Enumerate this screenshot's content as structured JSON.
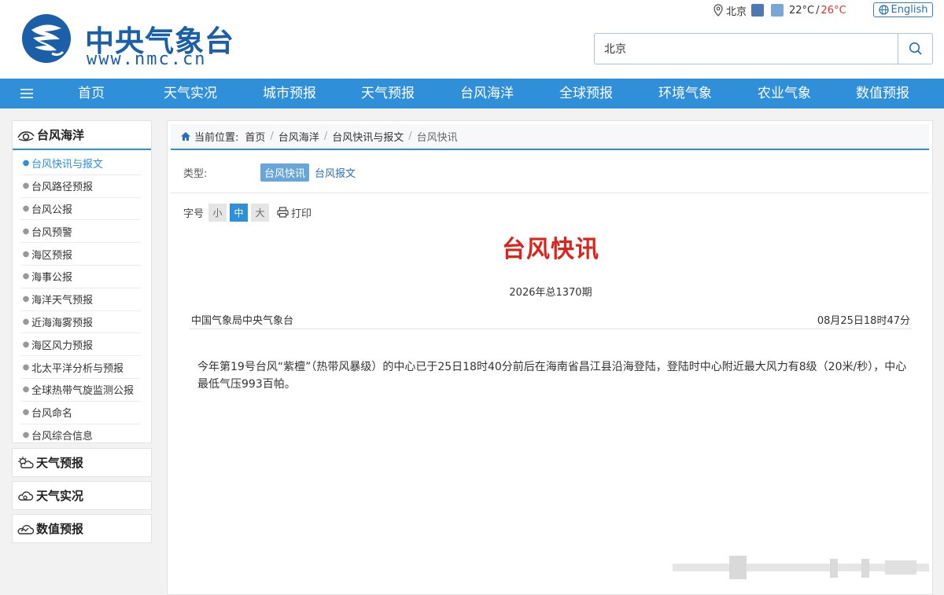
{
  "header": {
    "logo_cn": "中央气象台",
    "logo_url": "www.nmc.cn",
    "city": "北京",
    "temp_low": "22°C",
    "temp_sep": "/",
    "temp_high": "26°C",
    "lang_label": "English",
    "search_value": "北京"
  },
  "nav": {
    "items": [
      "首页",
      "天气实况",
      "城市预报",
      "天气预报",
      "台风海洋",
      "全球预报",
      "环境气象",
      "农业气象",
      "数值预报"
    ]
  },
  "sidebar": {
    "head": "台风海洋",
    "items": [
      {
        "label": "台风快讯与报文",
        "active": true
      },
      {
        "label": "台风路径预报"
      },
      {
        "label": "台风公报"
      },
      {
        "label": "台风预警"
      },
      {
        "label": "海区预报"
      },
      {
        "label": "海事公报"
      },
      {
        "label": "海洋天气预报"
      },
      {
        "label": "近海海雾预报"
      },
      {
        "label": "海区风力预报"
      },
      {
        "label": "北太平洋分析与预报"
      },
      {
        "label": "全球热带气旋监测公报"
      },
      {
        "label": "台风命名"
      },
      {
        "label": "台风综合信息"
      }
    ],
    "sections": [
      "天气预报",
      "天气实况",
      "数值预报"
    ]
  },
  "breadcrumb": {
    "prefix": "当前位置:",
    "items": [
      "首页",
      "台风海洋",
      "台风快讯与报文",
      "台风快讯"
    ]
  },
  "typebar": {
    "label": "类型:",
    "active": "台风快讯",
    "other": "台风报文"
  },
  "toolbar": {
    "font_label": "字号",
    "small": "小",
    "medium": "中",
    "large": "大",
    "print": "打印"
  },
  "article": {
    "title": "台风快讯",
    "issue": "2026年总1370期",
    "source": "中国气象局中央气象台",
    "time": "08月25日18时47分",
    "body": "今年第19号台风“紫檀”（热带风暴级）的中心已于25日18时40分前后在海南省昌江县沿海登陆，登陆时中心附近最大风力有8级（20米/秒），中心最低气压993百帕。"
  },
  "colors": {
    "brand_blue": "#2f8fd8",
    "title_red": "#d9251d",
    "temp_high": "#d9342b"
  }
}
